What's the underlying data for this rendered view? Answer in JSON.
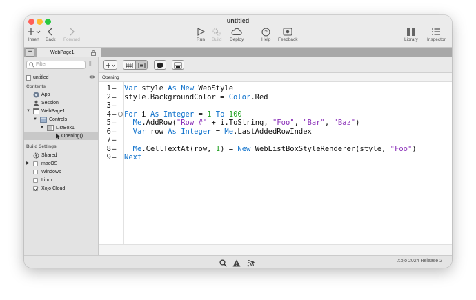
{
  "window": {
    "title": "untitled"
  },
  "toolbar": {
    "insert": "Insert",
    "back": "Back",
    "forward": "Forward",
    "run": "Run",
    "build": "Build",
    "deploy": "Deploy",
    "help": "Help",
    "feedback": "Feedback",
    "library": "Library",
    "inspector": "Inspector"
  },
  "tabs": [
    {
      "label": "WebPage1"
    }
  ],
  "navigator": {
    "filter_placeholder": "Filter",
    "project": "untitled",
    "contents_header": "Contents",
    "items": [
      {
        "label": "App"
      },
      {
        "label": "Session"
      },
      {
        "label": "WebPage1"
      },
      {
        "label": "Controls"
      },
      {
        "label": "ListBox1"
      },
      {
        "label": "Opening()"
      }
    ],
    "build_header": "Build Settings",
    "build_items": [
      {
        "label": "Shared",
        "checked": true
      },
      {
        "label": "macOS",
        "checked": false
      },
      {
        "label": "Windows",
        "checked": false
      },
      {
        "label": "Linux",
        "checked": false
      },
      {
        "label": "Xojo Cloud",
        "checked": true
      }
    ]
  },
  "editor": {
    "method_label": "Opening",
    "line_numbers": [
      "1",
      "2",
      "3",
      "4",
      "5",
      "6",
      "7",
      "8",
      "9"
    ],
    "lines": [
      [
        {
          "t": "kw",
          "v": "Var"
        },
        {
          "t": "",
          "v": " style "
        },
        {
          "t": "kw",
          "v": "As New"
        },
        {
          "t": "",
          "v": " WebStyle"
        }
      ],
      [
        {
          "t": "",
          "v": "style.BackgroundColor = "
        },
        {
          "t": "kw",
          "v": "Color"
        },
        {
          "t": "",
          "v": ".Red"
        }
      ],
      [],
      [
        {
          "t": "kw",
          "v": "For"
        },
        {
          "t": "",
          "v": " i "
        },
        {
          "t": "kw",
          "v": "As Integer"
        },
        {
          "t": "",
          "v": " = "
        },
        {
          "t": "nm",
          "v": "1"
        },
        {
          "t": "",
          "v": " "
        },
        {
          "t": "kw",
          "v": "To"
        },
        {
          "t": "",
          "v": " "
        },
        {
          "t": "nm",
          "v": "100"
        }
      ],
      [
        {
          "t": "",
          "v": "  "
        },
        {
          "t": "kw",
          "v": "Me"
        },
        {
          "t": "",
          "v": ".AddRow("
        },
        {
          "t": "st",
          "v": "\"Row #\""
        },
        {
          "t": "",
          "v": " + i.ToString, "
        },
        {
          "t": "st",
          "v": "\"Foo\""
        },
        {
          "t": "",
          "v": ", "
        },
        {
          "t": "st",
          "v": "\"Bar\""
        },
        {
          "t": "",
          "v": ", "
        },
        {
          "t": "st",
          "v": "\"Baz\""
        },
        {
          "t": "",
          "v": ")"
        }
      ],
      [
        {
          "t": "",
          "v": "  "
        },
        {
          "t": "kw",
          "v": "Var"
        },
        {
          "t": "",
          "v": " row "
        },
        {
          "t": "kw",
          "v": "As Integer"
        },
        {
          "t": "",
          "v": " = "
        },
        {
          "t": "kw",
          "v": "Me"
        },
        {
          "t": "",
          "v": ".LastAddedRowIndex"
        }
      ],
      [],
      [
        {
          "t": "",
          "v": "  "
        },
        {
          "t": "kw",
          "v": "Me"
        },
        {
          "t": "",
          "v": ".CellTextAt(row, "
        },
        {
          "t": "nm",
          "v": "1"
        },
        {
          "t": "",
          "v": ") = "
        },
        {
          "t": "kw",
          "v": "New"
        },
        {
          "t": "",
          "v": " WebListBoxStyleRenderer(style, "
        },
        {
          "t": "st",
          "v": "\"Foo\""
        },
        {
          "t": "",
          "v": ")"
        }
      ],
      [
        {
          "t": "kw",
          "v": "Next"
        }
      ]
    ]
  },
  "status": {
    "version": "Xojo 2024 Release 2"
  },
  "colors": {
    "keyword": "#0f72cc",
    "string": "#8a2fb8",
    "number": "#27a327",
    "close": "#ff5f57",
    "minimize": "#febc2e",
    "maximize": "#28c840"
  }
}
